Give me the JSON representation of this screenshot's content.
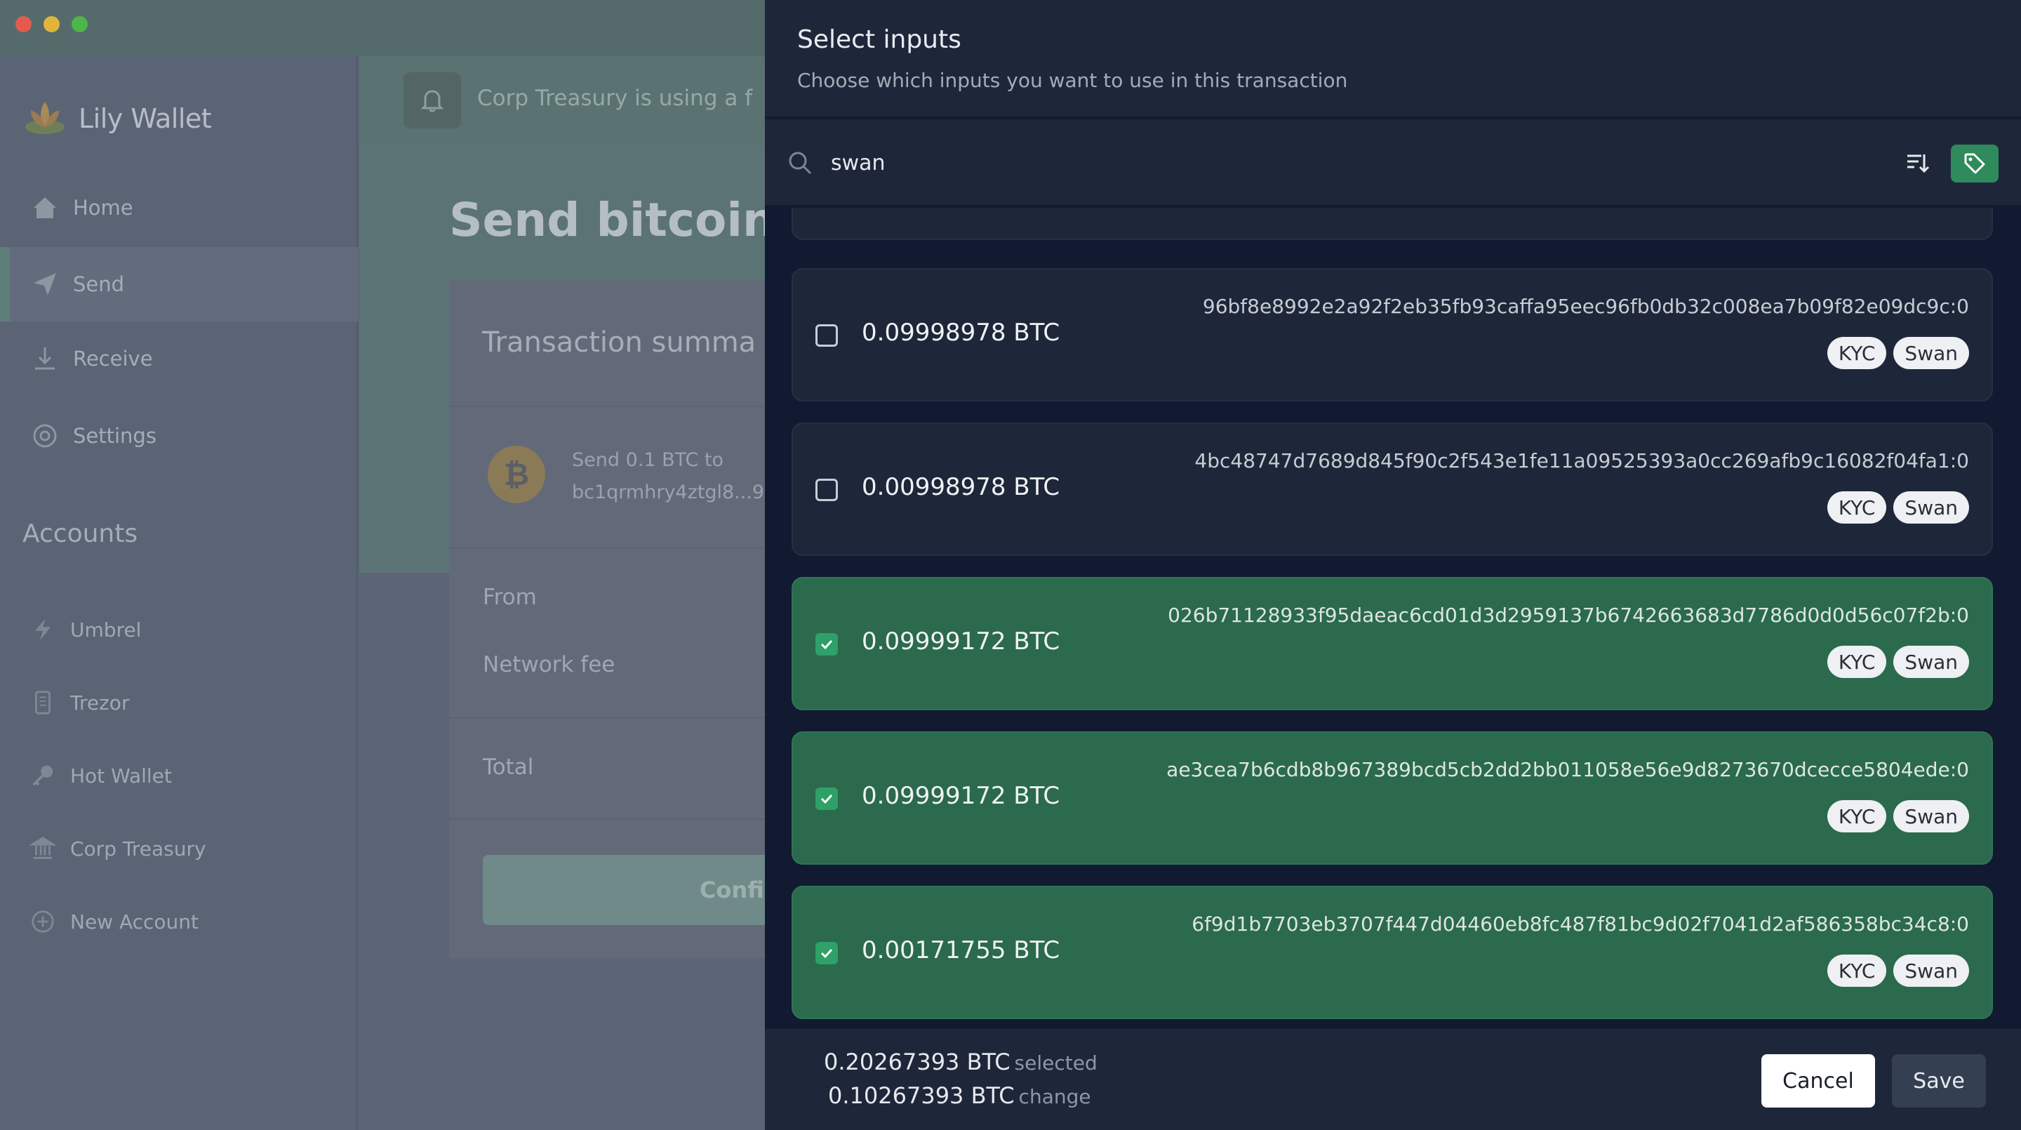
{
  "window": {
    "controls": [
      "close",
      "minimize",
      "zoom"
    ]
  },
  "sidebar": {
    "brand": "Lily Wallet",
    "nav": [
      {
        "label": "Home",
        "icon": "home-icon"
      },
      {
        "label": "Send",
        "icon": "send-icon",
        "active": true
      },
      {
        "label": "Receive",
        "icon": "receive-icon"
      },
      {
        "label": "Settings",
        "icon": "settings-icon"
      }
    ],
    "accounts_title": "Accounts",
    "accounts": [
      {
        "label": "Umbrel",
        "icon": "lightning-icon"
      },
      {
        "label": "Trezor",
        "icon": "hardware-device-icon"
      },
      {
        "label": "Hot Wallet",
        "icon": "key-icon"
      },
      {
        "label": "Corp Treasury",
        "icon": "bank-icon"
      },
      {
        "label": "New Account",
        "icon": "plus-circle-icon"
      }
    ]
  },
  "main": {
    "banner_text": "Corp Treasury is using a f",
    "page_title": "Send bitcoin",
    "summary": {
      "title": "Transaction summa",
      "send_line": "Send 0.1 BTC to",
      "address": "bc1qrmhry4ztgl8...9",
      "from_label": "From",
      "fee_label": "Network fee",
      "total_label": "Total",
      "confirm_label": "Confirm"
    }
  },
  "drawer": {
    "title": "Select inputs",
    "subtitle": "Choose which inputs you want to use in this transaction",
    "search": {
      "value": "swan"
    },
    "utxos": [
      {
        "amount": "",
        "txid": "",
        "selected": false,
        "tags": [
          "",
          ""
        ]
      },
      {
        "amount": "0.09998978 BTC",
        "txid": "96bf8e8992e2a92f2eb35fb93caffa95eec96fb0db32c008ea7b09f82e09dc9c:0",
        "selected": false,
        "tags": [
          "KYC",
          "Swan"
        ]
      },
      {
        "amount": "0.00998978 BTC",
        "txid": "4bc48747d7689d845f90c2f543e1fe11a09525393a0cc269afb9c16082f04fa1:0",
        "selected": false,
        "tags": [
          "KYC",
          "Swan"
        ]
      },
      {
        "amount": "0.09999172 BTC",
        "txid": "026b71128933f95daeac6cd01d3d2959137b6742663683d7786d0d0d56c07f2b:0",
        "selected": true,
        "tags": [
          "KYC",
          "Swan"
        ]
      },
      {
        "amount": "0.09999172 BTC",
        "txid": "ae3cea7b6cdb8b967389bcd5cb2dd2bb011058e56e9d8273670dcecce5804ede:0",
        "selected": true,
        "tags": [
          "KYC",
          "Swan"
        ]
      },
      {
        "amount": "0.00171755 BTC",
        "txid": "6f9d1b7703eb3707f447d04460eb8fc487f81bc9d02f7041d2af586358bc34c8:0",
        "selected": true,
        "tags": [
          "KYC",
          "Swan"
        ]
      }
    ],
    "footer": {
      "selected_amount": "0.20267393 BTC",
      "selected_label": "selected",
      "change_amount": "0.10267393 BTC",
      "change_label": "change",
      "cancel_label": "Cancel",
      "save_label": "Save"
    }
  },
  "colors": {
    "accent": "#2f8a5c",
    "selected_row": "#2b6a4c",
    "drawer_bg": "#1e2739"
  }
}
